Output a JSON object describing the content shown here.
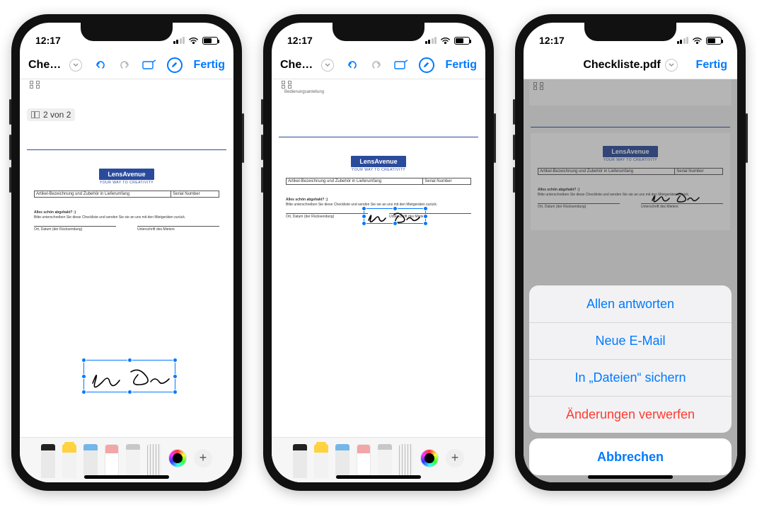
{
  "status": {
    "time": "12:17"
  },
  "toolbar": {
    "title_truncated": "Chec...",
    "title_full": "Checkliste.pdf",
    "done": "Fertig"
  },
  "page_counter": "2 von 2",
  "doc": {
    "checkbox_label": "Bedienungsanleitung",
    "brand": "LensAvenue",
    "tagline": "YOUR WAY TO CREATIVITY",
    "col_article": "Artikel-Bezeichnung und Zubehör in Lieferumfang",
    "col_serial": "Serial Number",
    "note_title": "Alles schön abgehakt? :)",
    "note_line": "Bitte unterschreiben Sie diese Checkliste und senden Sie sie an uns mit den Mietgeräten zurück.",
    "sig_left": "Ort, Datum (der Rücksendung)",
    "sig_right": "Unterschrift des Mieters"
  },
  "sheet": {
    "reply_all": "Allen antworten",
    "new_mail": "Neue E-Mail",
    "save_files": "In „Dateien“ sichern",
    "discard": "Änderungen verwerfen",
    "cancel": "Abbrechen"
  }
}
